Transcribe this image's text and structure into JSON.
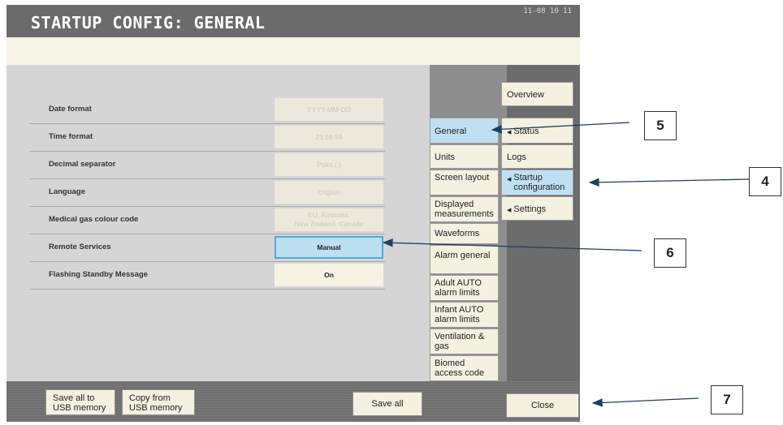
{
  "header": {
    "title": "STARTUP CONFIG: GENERAL",
    "clock": "11-08  10 11"
  },
  "settings": [
    {
      "label": "Date format",
      "value": "YYYY-MM-DD"
    },
    {
      "label": "Time format",
      "value": "23:59:59"
    },
    {
      "label": "Decimal separator",
      "value": "Point (.)"
    },
    {
      "label": "Language",
      "value": "English"
    },
    {
      "label": "Medical gas colour code",
      "value": "EU, Australia,\nNew Zealand, Canada"
    },
    {
      "label": "Remote Services",
      "value": "Manual"
    },
    {
      "label": "Flashing Standby Message",
      "value": "On"
    }
  ],
  "tabs": [
    {
      "label": "General"
    },
    {
      "label": "Units"
    },
    {
      "label": "Screen layout"
    },
    {
      "label": "Displayed measurements"
    },
    {
      "label": "Waveforms"
    },
    {
      "label": "Alarm general"
    },
    {
      "label": "Adult AUTO alarm limits"
    },
    {
      "label": "Infant AUTO alarm limits"
    },
    {
      "label": "Ventilation & gas"
    },
    {
      "label": "Biomed access code"
    }
  ],
  "nav": [
    {
      "label": "Overview"
    },
    {
      "label": "Status"
    },
    {
      "label": "Logs"
    },
    {
      "label": "Startup configuration"
    },
    {
      "label": "Settings"
    }
  ],
  "bottom": {
    "save_usb": "Save all to USB memory",
    "copy_usb": "Copy from USB memory",
    "save_all": "Save all",
    "close": "Close"
  },
  "callouts": {
    "c4": "4",
    "c5": "5",
    "c6": "6",
    "c7": "7"
  },
  "colors": {
    "selected": "#bfe0f2",
    "button": "#f4f1e0",
    "header": "#6b6b6b"
  }
}
